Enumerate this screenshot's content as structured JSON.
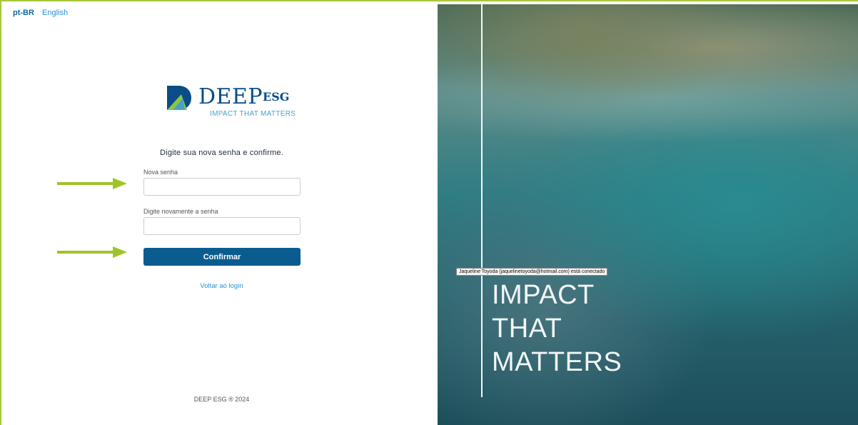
{
  "lang": {
    "active": "pt-BR",
    "other": "English"
  },
  "logo": {
    "word": "DEEP",
    "sup": "ESG",
    "tagline": "IMPACT THAT MATTERS"
  },
  "form": {
    "prompt": "Digite sua nova senha e confirme.",
    "new_password_label": "Nova senha",
    "new_password_value": "",
    "confirm_password_label": "Digite novamente a senha",
    "confirm_password_value": "",
    "submit_label": "Confirmar",
    "back_label": "Voltar ao login"
  },
  "footer": "DEEP ESG ® 2024",
  "hero": {
    "tooltip": "Jaqueline Toyoda (jaquelinetoyoda@hotmail.com) está conectado",
    "lines": [
      "IMPACT",
      "THAT",
      "MATTERS"
    ]
  },
  "colors": {
    "accent": "#0b5c8e",
    "link": "#2a8fd4",
    "arrow": "#9fc42a",
    "frame": "#a8c83a"
  }
}
